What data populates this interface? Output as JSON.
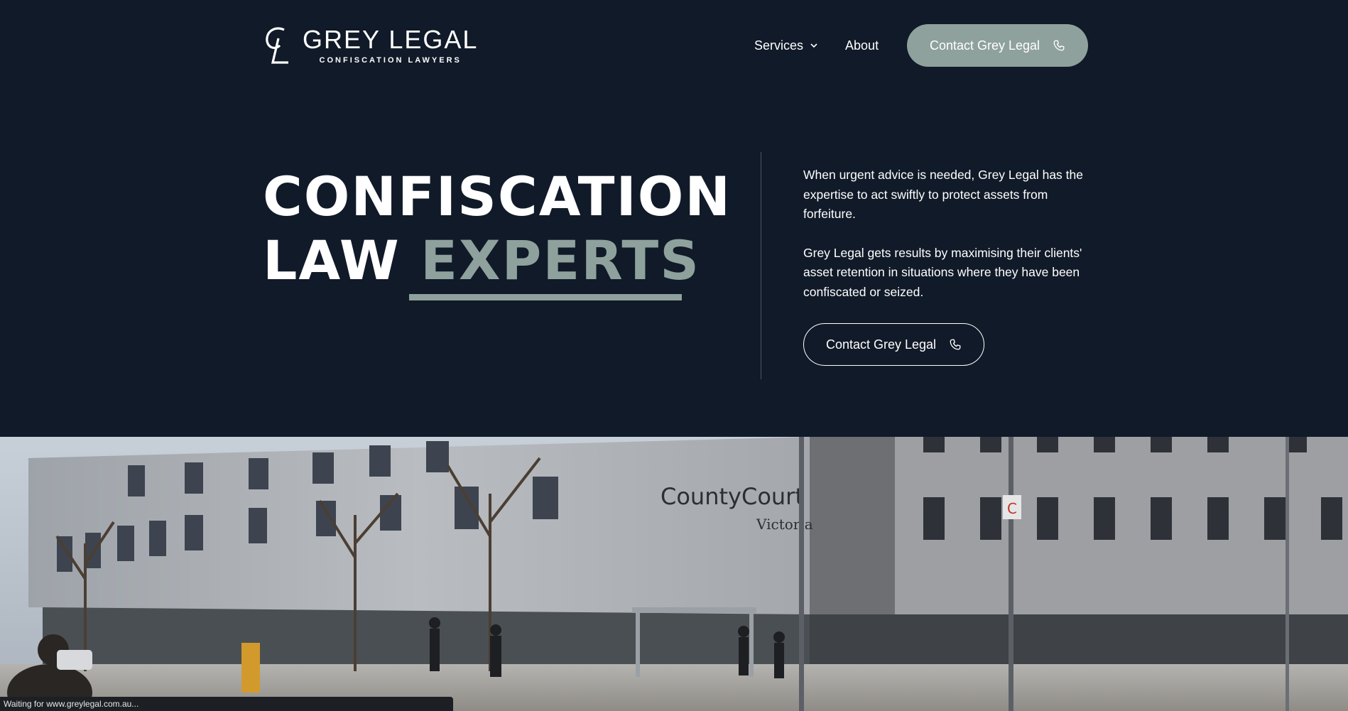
{
  "brand": {
    "name": "GREY LEGAL",
    "tagline": "CONFISCATION LAWYERS"
  },
  "nav": {
    "services_label": "Services",
    "about_label": "About",
    "contact_label": "Contact Grey Legal"
  },
  "hero": {
    "title_line1": "CONFISCATION",
    "title_line2_plain": "LAW ",
    "title_line2_accent": "EXPERTS",
    "paragraph1": "When urgent advice is needed, Grey Legal has the expertise to act swiftly to protect assets from forfeiture.",
    "paragraph2": "Grey Legal gets results by maximising their clients' asset retention in situations where they have been confiscated or seized.",
    "cta_label": "Contact Grey Legal"
  },
  "photo": {
    "signage_line1": "CountyCourt",
    "signage_line2": "Victoria",
    "sign_letter": "C"
  },
  "status_bar": {
    "text": "Waiting for www.greylegal.com.au..."
  },
  "colors": {
    "background": "#111a28",
    "accent": "#8fa19d",
    "text": "#ffffff"
  },
  "icons": {
    "chevron": "chevron-down-icon",
    "phone": "phone-icon",
    "logo": "gl-monogram-icon"
  }
}
